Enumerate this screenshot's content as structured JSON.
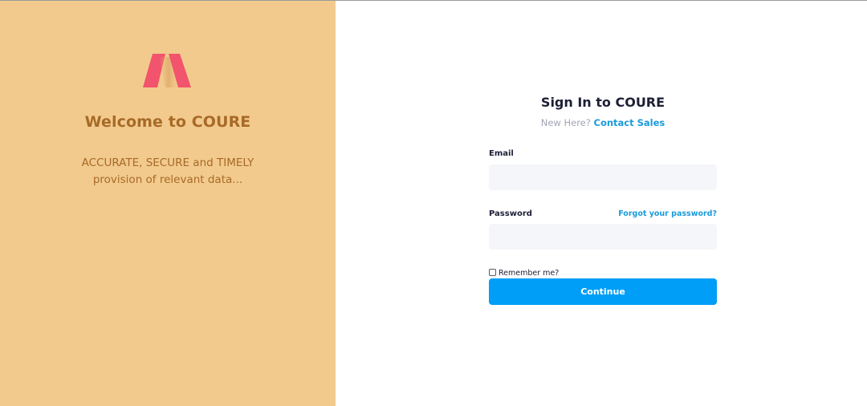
{
  "brand": {
    "logo_icon": "coure-logo-icon",
    "colors": {
      "panel_bg": "#f2ca8d",
      "brand_text": "#a86a27",
      "logo_red": "#f1546c",
      "accent": "#009ef7",
      "link": "#1a9bdb"
    }
  },
  "left_panel": {
    "welcome_title": "Welcome to COURE",
    "tagline_line1": "ACCURATE, SECURE and TIMELY",
    "tagline_line2": "provision of relevant data..."
  },
  "form": {
    "title": "Sign In to COURE",
    "new_here": "New Here?",
    "contact_sales": "Contact Sales",
    "email_label": "Email",
    "email_value": "",
    "password_label": "Password",
    "password_value": "",
    "forgot_password": "Forgot your password?",
    "remember_me": "Remember me?",
    "remember_checked": false,
    "continue_label": "Continue"
  }
}
